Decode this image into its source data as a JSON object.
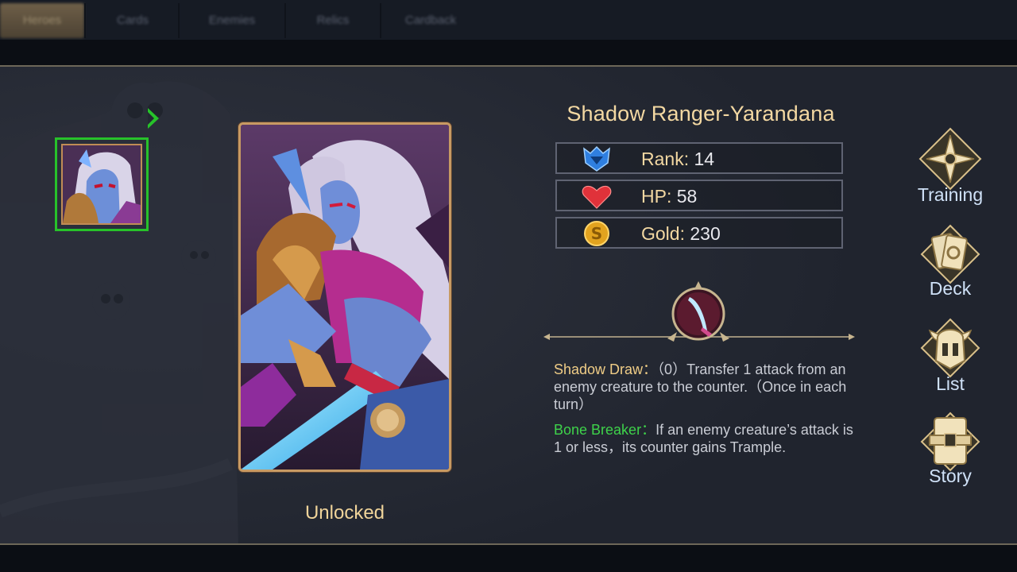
{
  "tabs": [
    {
      "label": "Heroes",
      "active": true
    },
    {
      "label": "Cards",
      "active": false
    },
    {
      "label": "Enemies",
      "active": false
    },
    {
      "label": "Relics",
      "active": false
    },
    {
      "label": "Cardback",
      "active": false
    }
  ],
  "hero": {
    "name": "Shadow Ranger-Yarandana",
    "status": "Unlocked",
    "stats": [
      {
        "label": "Rank:",
        "value": "14",
        "icon": "rank-crest-icon"
      },
      {
        "label": "HP:",
        "value": "58",
        "icon": "heart-icon"
      },
      {
        "label": "Gold:",
        "value": "230",
        "icon": "gold-coin-icon"
      }
    ],
    "skills": [
      {
        "name": "Shadow Draw：",
        "text": "（0）Transfer 1 attack from an enemy creature to the counter.（Once in each turn）"
      },
      {
        "name": "Bone Breaker：",
        "text": "If an enemy creature’s attack is 1 or less，its counter gains Trample."
      }
    ]
  },
  "menu": [
    {
      "label": "Training",
      "icon": "compass-star-icon"
    },
    {
      "label": "Deck",
      "icon": "card-deck-icon"
    },
    {
      "label": "List",
      "icon": "horned-helmet-icon"
    },
    {
      "label": "Story",
      "icon": "book-icon"
    }
  ],
  "colors": {
    "accent_gold": "#f3d8a2",
    "skill_gold": "#f0cd86",
    "skill_green": "#3ed24a",
    "selection_green": "#27c22a",
    "menu_text": "#cfe1f7"
  }
}
